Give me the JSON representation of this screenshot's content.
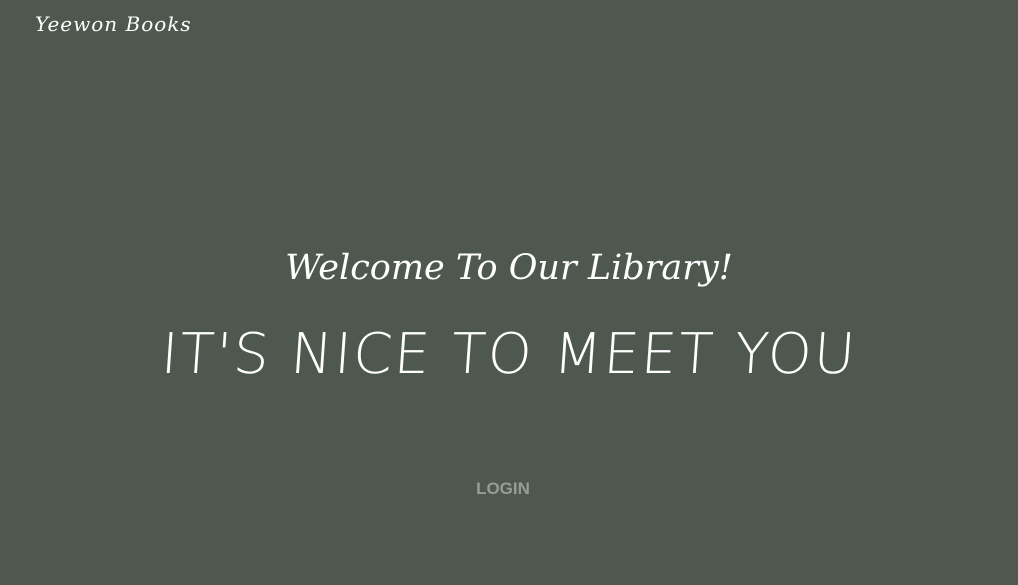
{
  "header": {
    "brand": "Yeewon Books"
  },
  "hero": {
    "welcome": "Welcome To Our Library!",
    "headline": "IT'S NICE TO MEET YOU",
    "login_label": "LOGIN"
  },
  "colors": {
    "background": "#4f584f",
    "text": "#ffffff",
    "login": "#979c97"
  }
}
